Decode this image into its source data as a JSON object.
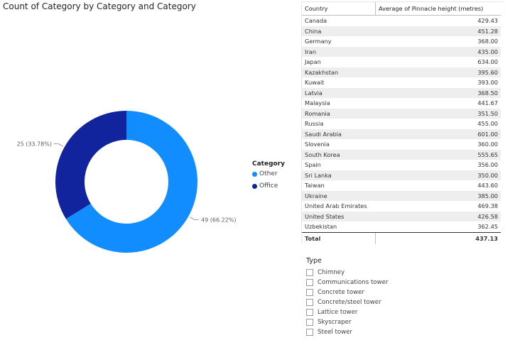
{
  "donut": {
    "title": "Count of Category by Category and Category",
    "legend_title": "Category",
    "legend_items": [
      {
        "label": "Other",
        "color": "#118DFF"
      },
      {
        "label": "Office",
        "color": "#12239E"
      }
    ]
  },
  "chart_data": {
    "type": "pie",
    "title": "Count of Category by Category and Category",
    "legend_title": "Category",
    "slices": [
      {
        "name": "Other",
        "value": 49,
        "percent": 66.22,
        "label": "49 (66.22%)",
        "color": "#118DFF"
      },
      {
        "name": "Office",
        "value": 25,
        "percent": 33.78,
        "label": "25 (33.78%)",
        "color": "#12239E"
      }
    ],
    "donut": true
  },
  "table": {
    "headers": [
      "Country",
      "Average of Pinnacle height (metres)"
    ],
    "rows": [
      [
        "Canada",
        "429.43"
      ],
      [
        "China",
        "451.28"
      ],
      [
        "Germany",
        "368.00"
      ],
      [
        "Iran",
        "435.00"
      ],
      [
        "Japan",
        "634.00"
      ],
      [
        "Kazakhstan",
        "395.60"
      ],
      [
        "Kuwait",
        "393.00"
      ],
      [
        "Latvia",
        "368.50"
      ],
      [
        "Malaysia",
        "441.67"
      ],
      [
        "Romania",
        "351.50"
      ],
      [
        "Russia",
        "455.00"
      ],
      [
        "Saudi Arabia",
        "601.00"
      ],
      [
        "Slovenia",
        "360.00"
      ],
      [
        "South Korea",
        "555.65"
      ],
      [
        "Spain",
        "356.00"
      ],
      [
        "Sri Lanka",
        "350.00"
      ],
      [
        "Taiwan",
        "443.60"
      ],
      [
        "Ukraine",
        "385.00"
      ],
      [
        "United Arab Emirates",
        "469.38"
      ],
      [
        "United States",
        "426.58"
      ],
      [
        "Uzbekistan",
        "362.45"
      ]
    ],
    "total": [
      "Total",
      "437.13"
    ]
  },
  "slicer": {
    "title": "Type",
    "items": [
      "Chimney",
      "Communications tower",
      "Concrete tower",
      "Concrete/steel tower",
      "Lattice tower",
      "Skyscraper",
      "Steel tower"
    ]
  }
}
